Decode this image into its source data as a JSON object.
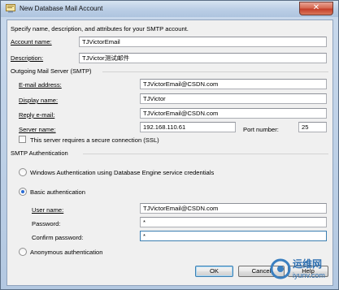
{
  "window": {
    "title": "New Database Mail Account",
    "close_glyph": "✕"
  },
  "intro_text": "Specify name, description, and attributes for your SMTP account.",
  "account": {
    "name_label": "Account name:",
    "name_value": "TJVictorEmail",
    "description_label": "Description:",
    "description_value": "TJVictor测试邮件"
  },
  "smtp": {
    "group_title": "Outgoing Mail Server (SMTP)",
    "email_label": "E-mail address:",
    "email_value": "TJVictorEmail@CSDN.com",
    "display_label": "Display name:",
    "display_value": "TJVictor",
    "reply_label": "Reply e-mail:",
    "reply_value": "TJVictorEmail@CSDN.com",
    "server_label": "Server name:",
    "server_value": "192.168.110.61",
    "port_label": "Port number:",
    "port_value": "25",
    "ssl_label": "This server requires a secure connection (SSL)",
    "ssl_checked": false
  },
  "auth": {
    "group_title": "SMTP Authentication",
    "windows_label": "Windows Authentication using Database Engine service credentials",
    "basic_label": "Basic authentication",
    "user_label": "User name:",
    "user_value": "TJVictorEmail@CSDN.com",
    "password_label": "Password:",
    "password_value": "*",
    "confirm_label": "Confirm password:",
    "confirm_value": "*",
    "anonymous_label": "Anonymous authentication",
    "selected": "basic"
  },
  "buttons": {
    "ok": "OK",
    "cancel": "Cancel",
    "help": "Help"
  },
  "watermark": {
    "text_cn": "运维网",
    "text_url": "iyunv.com"
  }
}
